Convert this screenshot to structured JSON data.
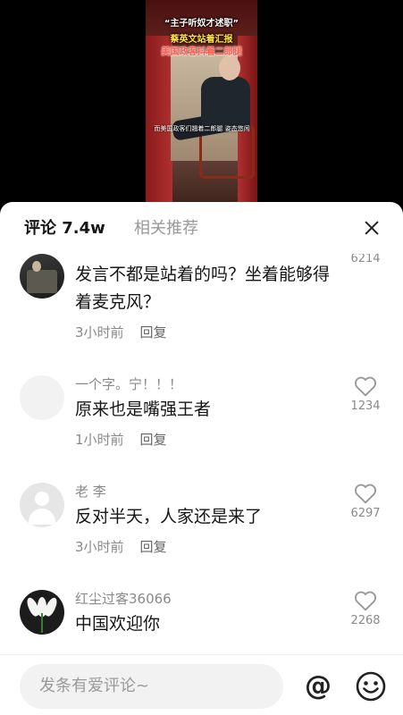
{
  "video": {
    "caption_line1": "“主子听奴才述职”",
    "caption_line2": "蔡英文站着汇报",
    "caption_line3": "美国政客抖着二郎腿",
    "subtitle": "而美国政客们翘着二郎腿 姿态悠闲"
  },
  "header": {
    "comments_tab_label": "评论",
    "comments_count": "7.4w",
    "related_tab_label": "相关推荐"
  },
  "comments": [
    {
      "username": "",
      "text": "发言不都是站着的吗？坐着能够得着麦克风？",
      "time": "3小时前",
      "reply_label": "回复",
      "likes": "6214"
    },
    {
      "username": "一个字。宁！！！",
      "text": "原来也是嘴强王者",
      "time": "1小时前",
      "reply_label": "回复",
      "likes": "1234"
    },
    {
      "username": "老 李",
      "text": "反对半天，人家还是来了",
      "time": "3小时前",
      "reply_label": "回复",
      "likes": "6297"
    },
    {
      "username": "红尘过客36066",
      "text": "中国欢迎你",
      "time": "",
      "reply_label": "",
      "likes": "2268"
    }
  ],
  "input": {
    "placeholder": "发条有爱评论~",
    "at_symbol": "@"
  },
  "colors": {
    "panel_bg": "#ffffff",
    "text_primary": "#161616",
    "text_secondary": "#8a8a8a",
    "input_bg": "#f2f2f2"
  }
}
